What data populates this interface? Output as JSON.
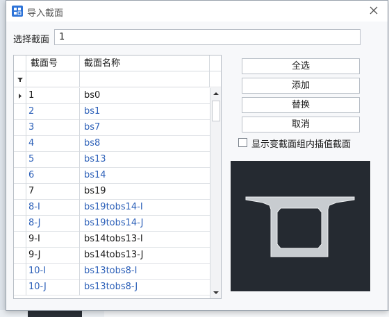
{
  "window": {
    "title": "导入截面",
    "close_icon": "close-icon",
    "app_icon": "app-icon"
  },
  "selection": {
    "label": "选择截面",
    "value": "1"
  },
  "grid": {
    "columns": [
      "截面号",
      "截面名称"
    ],
    "rows": [
      {
        "no": "1",
        "name": "bs0",
        "current": true,
        "blue": false
      },
      {
        "no": "2",
        "name": "bs1",
        "current": false,
        "blue": true
      },
      {
        "no": "3",
        "name": "bs7",
        "current": false,
        "blue": true
      },
      {
        "no": "4",
        "name": "bs8",
        "current": false,
        "blue": true
      },
      {
        "no": "5",
        "name": "bs13",
        "current": false,
        "blue": true
      },
      {
        "no": "6",
        "name": "bs14",
        "current": false,
        "blue": true
      },
      {
        "no": "7",
        "name": "bs19",
        "current": false,
        "blue": false
      },
      {
        "no": "8-I",
        "name": "bs19tobs14-I",
        "current": false,
        "blue": true
      },
      {
        "no": "8-J",
        "name": "bs19tobs14-J",
        "current": false,
        "blue": true
      },
      {
        "no": "9-I",
        "name": "bs14tobs13-I",
        "current": false,
        "blue": false
      },
      {
        "no": "9-J",
        "name": "bs14tobs13-J",
        "current": false,
        "blue": false
      },
      {
        "no": "10-I",
        "name": "bs13tobs8-I",
        "current": false,
        "blue": true
      },
      {
        "no": "10-J",
        "name": "bs13tobs8-J",
        "current": false,
        "blue": true
      }
    ]
  },
  "buttons": {
    "select_all": "全选",
    "add": "添加",
    "replace": "替换",
    "cancel": "取消"
  },
  "checkbox": {
    "label": "显示变截面组内插值截面",
    "checked": false
  },
  "colors": {
    "accent_text": "#2b5fb8",
    "preview_bg": "#252a31"
  }
}
